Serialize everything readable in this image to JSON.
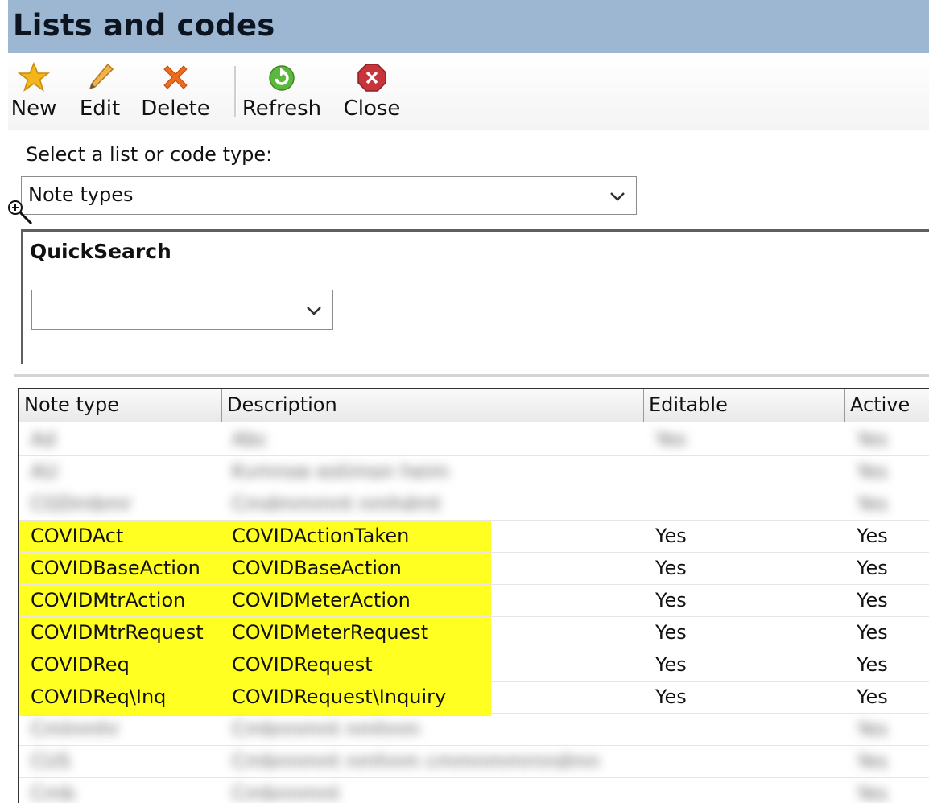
{
  "window": {
    "title": "Lists and codes"
  },
  "toolbar": {
    "new_label": "New",
    "edit_label": "Edit",
    "delete_label": "Delete",
    "refresh_label": "Refresh",
    "close_label": "Close"
  },
  "icons": {
    "new": "star-icon",
    "edit": "pencil-icon",
    "delete": "x-icon",
    "refresh": "refresh-icon",
    "close": "close-icon",
    "zoom": "zoom-in-icon"
  },
  "colors": {
    "title_bar": "#9db6d2",
    "highlight": "#ffff22",
    "star": "#f2b51b",
    "delete": "#f06a1c",
    "refresh": "#5cb83c",
    "close": "#c7353a"
  },
  "selector": {
    "label": "Select a list or code type:",
    "value": "Note types"
  },
  "quicksearch": {
    "title": "QuickSearch",
    "value": ""
  },
  "grid": {
    "columns": [
      "Note type",
      "Description",
      "Editable",
      "Active"
    ],
    "blurred_rows": [
      [
        "Ad",
        "Abc",
        "Yes",
        "Yes"
      ],
      [
        "AU",
        "Kvmnoe estimon heim",
        "",
        "Yes"
      ],
      [
        "CGDmbmr",
        "Cmdmmmnt nmhdmt",
        "",
        "Yes"
      ]
    ],
    "rows": [
      [
        "COVIDAct",
        "COVIDActionTaken",
        "Yes",
        "Yes"
      ],
      [
        "COVIDBaseAction",
        "COVIDBaseAction",
        "Yes",
        "Yes"
      ],
      [
        "COVIDMtrAction",
        "COVIDMeterAction",
        "Yes",
        "Yes"
      ],
      [
        "COVIDMtrRequest",
        "COVIDMeterRequest",
        "Yes",
        "Yes"
      ],
      [
        "COVIDReq",
        "COVIDRequest",
        "Yes",
        "Yes"
      ],
      [
        "COVIDReq\\Inq",
        "COVIDRequest\\Inquiry",
        "Yes",
        "Yes"
      ]
    ],
    "blurred_rows_after": [
      [
        "Cmlnmhr",
        "Cmbnnmnt nmhnm",
        "",
        "Yes"
      ],
      [
        "CUS",
        "Cmbnnmnt nmhnm cmmnmmrnndmn",
        "",
        "Yes"
      ],
      [
        "Cmb",
        "Cmbnnmnt",
        "",
        "Yes"
      ]
    ]
  }
}
